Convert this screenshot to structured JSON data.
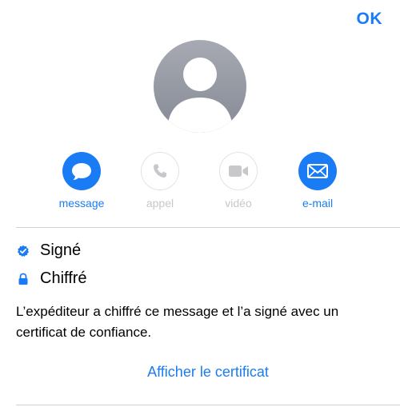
{
  "header": {
    "ok_label": "OK"
  },
  "contact": {
    "avatar_icon": "person-silhouette-icon"
  },
  "actions": [
    {
      "label": "message",
      "icon": "message-bubble-icon",
      "enabled": true
    },
    {
      "label": "appel",
      "icon": "phone-icon",
      "enabled": false
    },
    {
      "label": "vidéo",
      "icon": "video-camera-icon",
      "enabled": false
    },
    {
      "label": "e-mail",
      "icon": "envelope-icon",
      "enabled": true
    }
  ],
  "security": {
    "signed_label": "Signé",
    "encrypted_label": "Chiffré",
    "description": "L’expéditeur a chiffré ce message et l’a signé avec un certificat de confiance.",
    "view_certificate_label": "Afficher le certificat"
  },
  "colors": {
    "accent": "#1a7cf5",
    "disabled": "#c7c7cc",
    "avatar_gradient_top": "#a7aab3",
    "avatar_gradient_bottom": "#858a94"
  }
}
